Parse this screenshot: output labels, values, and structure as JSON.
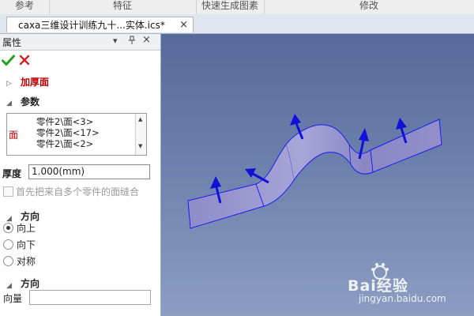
{
  "ribbon": {
    "groups": [
      "参考",
      "特征",
      "快速生成图素",
      "修改"
    ]
  },
  "tabs": {
    "active_title": "caxa三维设计训练九十...实体.ics*",
    "close_glyph": "×"
  },
  "panel": {
    "title": "属性",
    "pin_glyph": "▾",
    "autohide_glyph": "ㅁ",
    "close_glyph": "×",
    "ok_icon": "check-icon",
    "cancel_icon": "x-icon",
    "feature_name": "加厚面",
    "params_section": "参数",
    "face_label": "面",
    "face_items": [
      "零件2\\面<3>",
      "零件2\\面<17>",
      "零件2\\面<2>"
    ],
    "thickness_label": "厚度",
    "thickness_value": "1.000(mm)",
    "stitch_checkbox_label": "首先把来自多个零件的面缝合",
    "stitch_checked": false,
    "direction_section": "方向",
    "direction_options": [
      "向上",
      "向下",
      "对称"
    ],
    "direction_selected": "向上",
    "direction2_section": "方向",
    "vector_label": "向量",
    "vector_value": ""
  },
  "viewport": {
    "background_top": "#566a9b",
    "background_bottom": "#8b9dc1",
    "surface_color": "#8f8cc9",
    "edge_color": "#1c1cf0",
    "arrow_color": "#1010d8"
  },
  "watermark": {
    "brand": "Bai经验",
    "url": "jingyan.baidu.com"
  }
}
